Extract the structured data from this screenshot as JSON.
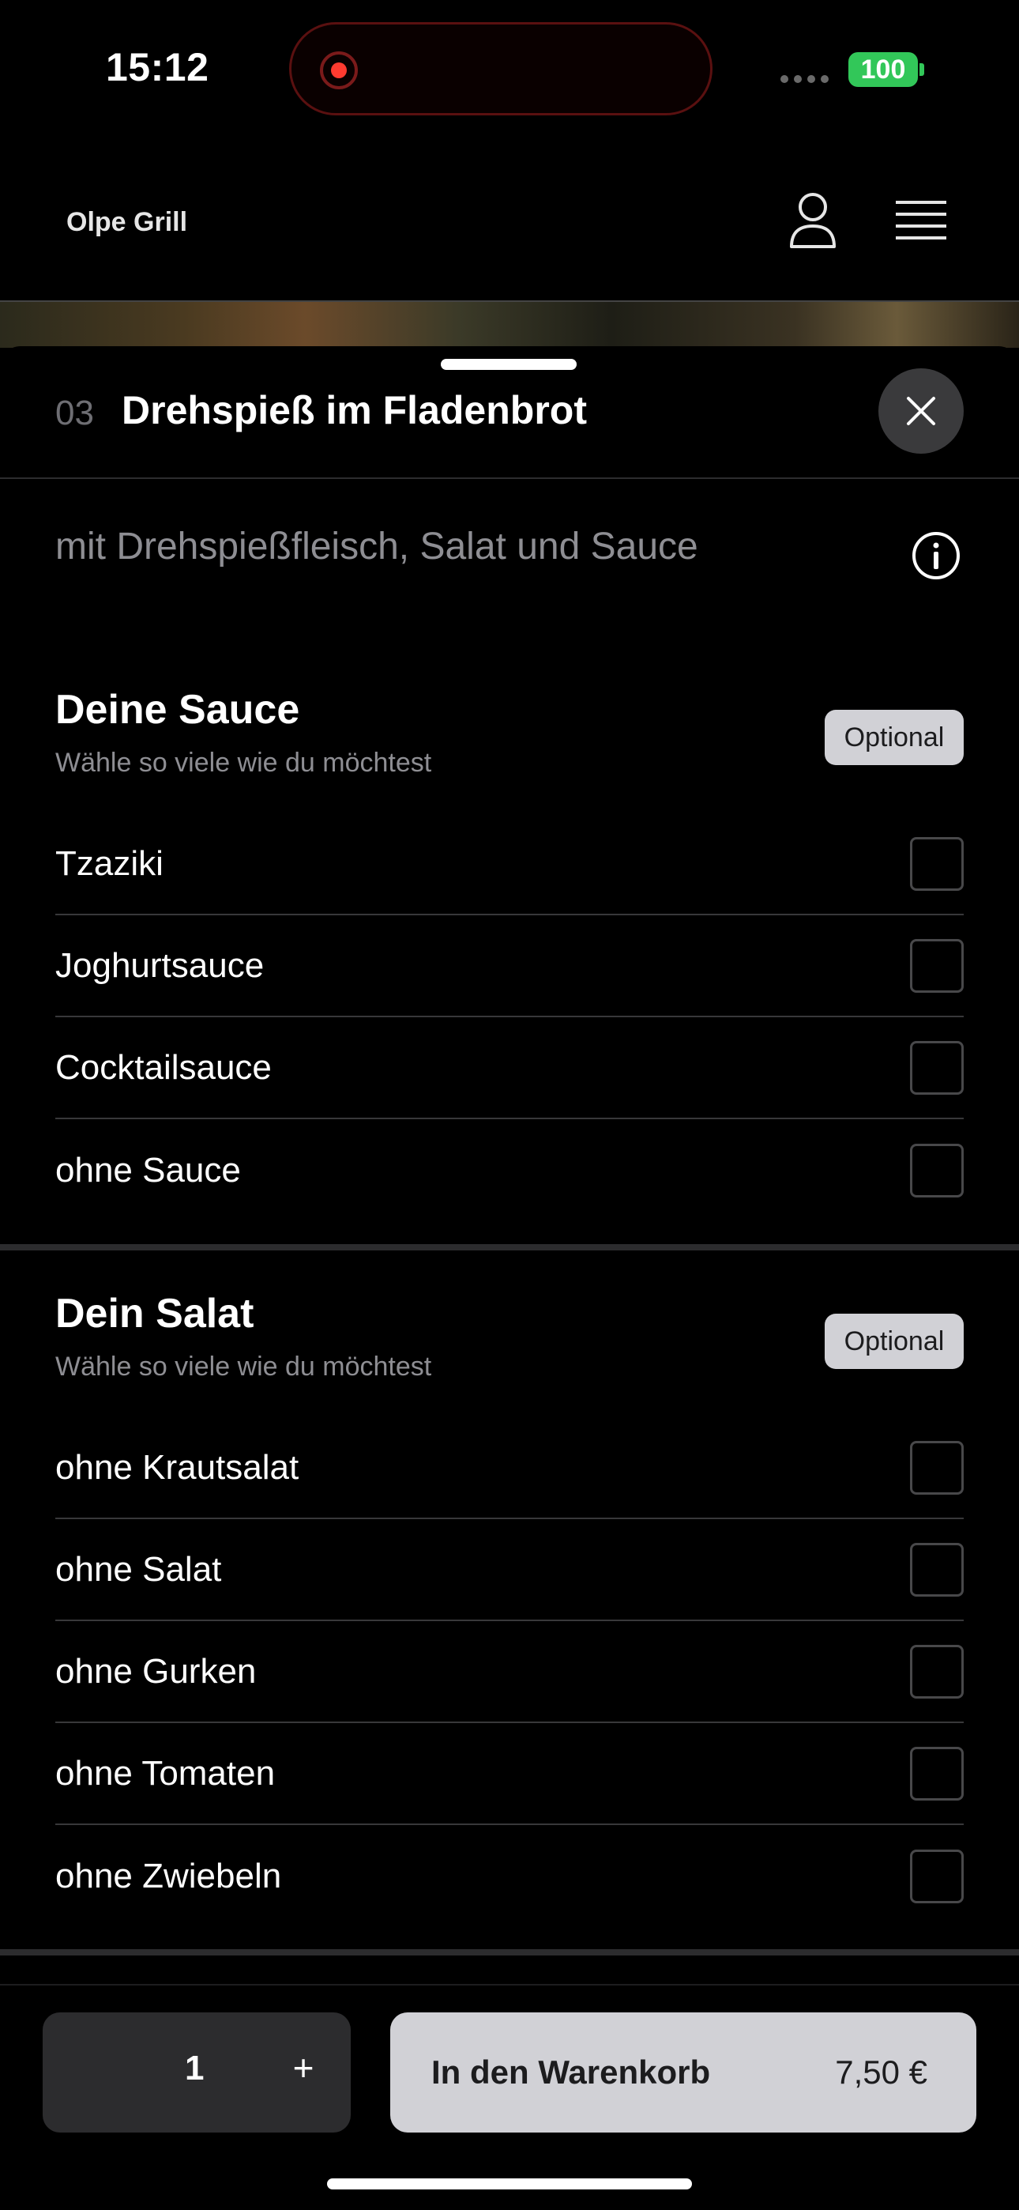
{
  "status_bar": {
    "time": "15:12",
    "battery": "100",
    "battery_color": "#32c759",
    "recording_color": "#ff3b30"
  },
  "header": {
    "app_title": "Olpe Grill",
    "icons": [
      "user-icon",
      "menu-icon"
    ]
  },
  "item": {
    "number": "03",
    "title": "Drehspieß im Fladenbrot",
    "description": "mit Drehspießfleisch, Salat und Sauce"
  },
  "sections": [
    {
      "title": "Deine Sauce",
      "subtitle": "Wähle so viele wie du möchtest",
      "badge": "Optional",
      "options": [
        "Tzaziki",
        "Joghurtsauce",
        "Cocktailsauce",
        "ohne Sauce"
      ]
    },
    {
      "title": "Dein Salat",
      "subtitle": "Wähle so viele wie du möchtest",
      "badge": "Optional",
      "options": [
        "ohne Krautsalat",
        "ohne Salat",
        "ohne Gurken",
        "ohne Tomaten",
        "ohne Zwiebeln"
      ]
    }
  ],
  "bottom_bar": {
    "quantity": "1",
    "plus_label": "+",
    "add_to_cart_label": "In den Warenkorb",
    "price": "7,50 €"
  }
}
